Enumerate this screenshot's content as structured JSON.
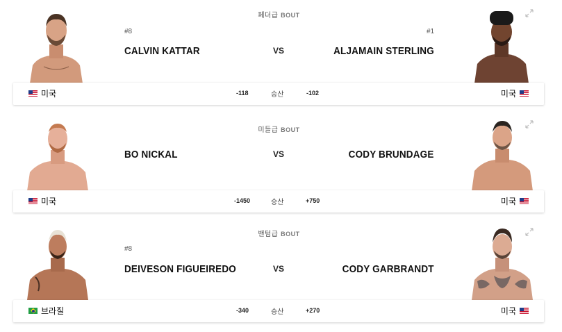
{
  "fights": [
    {
      "weight_class": "페더급",
      "bout_label": "BOUT",
      "red": {
        "rank": "#8",
        "name": "CALVIN KATTAR",
        "country": "미국",
        "flag": "us",
        "odds": "-118"
      },
      "blue": {
        "rank": "#1",
        "name": "ALJAMAIN STERLING",
        "country": "미국",
        "flag": "us",
        "odds": "-102"
      },
      "vs": "VS",
      "odds_label": "승산"
    },
    {
      "weight_class": "미들급",
      "bout_label": "BOUT",
      "red": {
        "rank": "",
        "name": "BO NICKAL",
        "country": "미국",
        "flag": "us",
        "odds": "-1450"
      },
      "blue": {
        "rank": "",
        "name": "CODY BRUNDAGE",
        "country": "미국",
        "flag": "us",
        "odds": "+750"
      },
      "vs": "VS",
      "odds_label": "승산"
    },
    {
      "weight_class": "밴텀급",
      "bout_label": "BOUT",
      "red": {
        "rank": "#8",
        "name": "DEIVESON FIGUEIREDO",
        "country": "브라질",
        "flag": "br",
        "odds": "-340"
      },
      "blue": {
        "rank": "",
        "name": "CODY GARBRANDT",
        "country": "미국",
        "flag": "us",
        "odds": "+270"
      },
      "vs": "VS",
      "odds_label": "승산"
    }
  ],
  "colors": {
    "skin_light": "#d9a58a",
    "skin_mid": "#c98b6c",
    "skin_dark": "#6e4332",
    "card_bg": "#ffffff",
    "text": "#111111"
  },
  "icons": {
    "expand": "expand-arrows-icon"
  }
}
